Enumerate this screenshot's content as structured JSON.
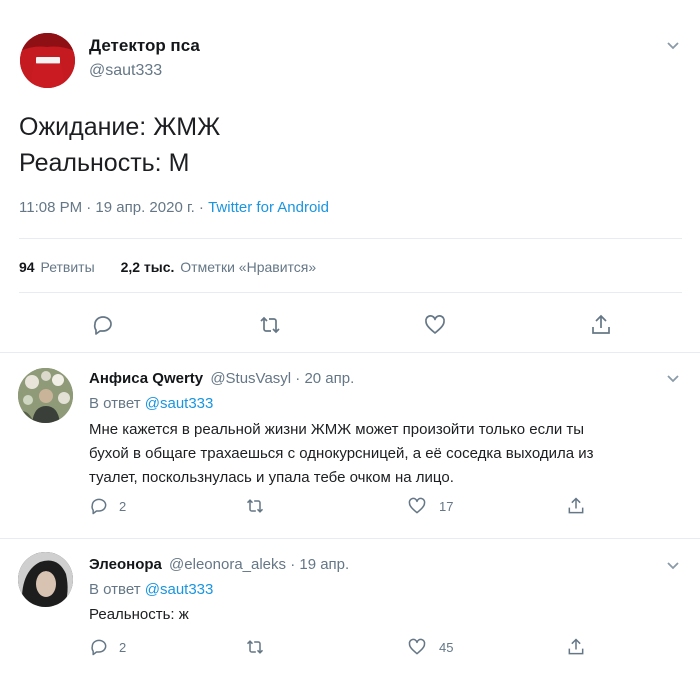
{
  "main_tweet": {
    "author_name": "Детектор пса",
    "author_handle": "@saut333",
    "text_line1": "Ожидание: ЖМЖ",
    "text_line2": "Реальность: М",
    "time_date": "11:08 PM · 19 апр. 2020 г. · ",
    "source": "Twitter for Android",
    "retweets_count": "94",
    "retweets_label": "Ретвиты",
    "likes_count": "2,2 тыс.",
    "likes_label": "Отметки «Нравится»"
  },
  "replies": [
    {
      "author_name": "Анфиса Qwerty",
      "author_handle": "@StusVasyl",
      "date": "· 20 апр.",
      "reply_to_label": "В ответ ",
      "reply_to_handle": "@saut333",
      "text_line1": "Мне кажется в реальной жизни ЖМЖ может произойти только если ты",
      "text_line2": "бухой в общаге трахаешься с однокурсницей, а её соседка выходила из",
      "text_line3": "туалет, поскользнулась и упала тебе очком на лицо.",
      "reply_count": "2",
      "like_count": "17"
    },
    {
      "author_name": "Элеонора",
      "author_handle": "@eleonora_aleks",
      "date": "· 19 апр.",
      "reply_to_label": "В ответ ",
      "reply_to_handle": "@saut333",
      "text_line1": "Реальность: ж",
      "reply_count": "2",
      "like_count": "45"
    }
  ],
  "icons": [
    "chevron-down-icon",
    "reply-icon",
    "retweet-icon",
    "like-icon",
    "share-icon"
  ],
  "colors": {
    "link": "#1b95e0",
    "muted": "#657786",
    "divider": "#e6ecf0"
  }
}
